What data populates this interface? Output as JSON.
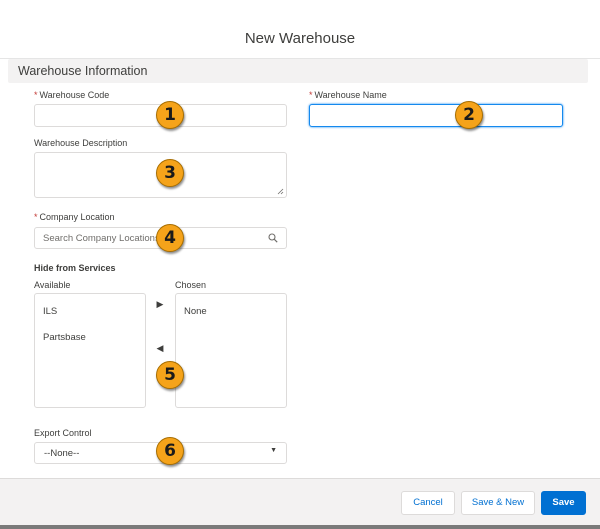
{
  "modal": {
    "title": "New Warehouse"
  },
  "section": {
    "title": "Warehouse Information"
  },
  "fields": {
    "warehouse_code": {
      "label": "Warehouse Code",
      "required_mark": "*",
      "value": ""
    },
    "warehouse_name": {
      "label": "Warehouse Name",
      "required_mark": "*",
      "value": ""
    },
    "warehouse_description": {
      "label": "Warehouse Description",
      "value": ""
    },
    "company_location": {
      "label": "Company Location",
      "required_mark": "*",
      "placeholder": "Search Company Locations...",
      "icon": "search-icon"
    },
    "hide_from_services": {
      "label": "Hide from Services",
      "available_label": "Available",
      "chosen_label": "Chosen",
      "available_options": [
        "ILS",
        "Partsbase"
      ],
      "chosen_options": [
        "None"
      ],
      "move_right_icon": "triangle-right-icon",
      "move_left_icon": "triangle-left-icon"
    },
    "export_control": {
      "label": "Export Control",
      "selected": "--None--",
      "icon": "caret-down-icon"
    }
  },
  "callouts": [
    "1",
    "2",
    "3",
    "4",
    "5",
    "6"
  ],
  "footer": {
    "cancel_label": "Cancel",
    "save_new_label": "Save & New",
    "save_label": "Save"
  },
  "colors": {
    "accent": "#0070d2",
    "callout": "#f5a31a",
    "required": "#c23934",
    "focus": "#1589ee"
  }
}
